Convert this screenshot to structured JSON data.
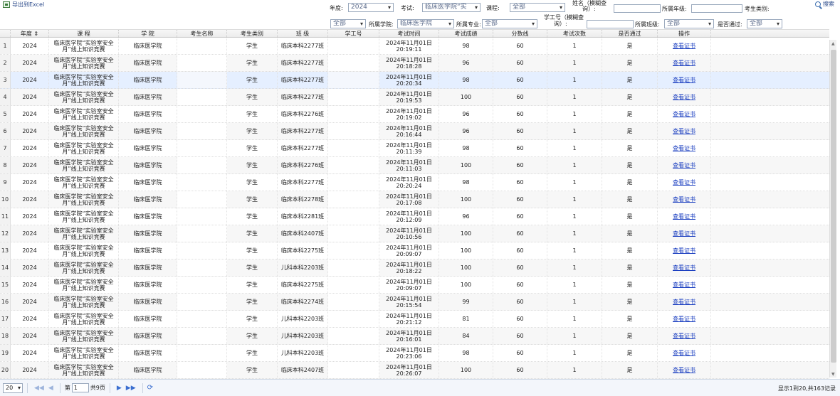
{
  "toolbar": {
    "export_label": "导出到Excel",
    "search_label": "搜索"
  },
  "filters": {
    "year_label": "年度:",
    "year_value": "2024",
    "exam_label": "考试:",
    "exam_value": "临床医学院“实",
    "course_label": "课程:",
    "course_value": "全部",
    "name_label_1": "姓名（模糊查",
    "name_label_2": "询）:",
    "grade_label": "所属年级:",
    "category_label": "考生类别:",
    "category_value": "全部",
    "college_label": "所属学院:",
    "college_value": "临床医学院",
    "major_label": "所属专业:",
    "major_value": "全部",
    "id_label_1": "学工号（模糊查",
    "id_label_2": "询）:",
    "class_label": "所属班级:",
    "class_value": "全部",
    "pass_label": "是否通过:",
    "pass_value": "全部"
  },
  "table": {
    "headers": [
      "",
      "年度 ⇕",
      "课 程",
      "学 院",
      "考生名称",
      "考生类别",
      "班 级",
      "学工号",
      "考试时间",
      "考试成绩",
      "分数线",
      "考试次数",
      "是否通过",
      "操作"
    ],
    "rows": [
      {
        "n": "1",
        "year": "2024",
        "course_1": "临床医学院“实验室安全",
        "course_2": "月”线上知识竞赛",
        "college": "临床医学院",
        "name": "",
        "type": "学生",
        "klass": "临床本科2277班",
        "id": "",
        "date": "2024年11月01日",
        "time": "20:19:11",
        "score": "98",
        "line": "60",
        "times": "1",
        "pass": "是",
        "op": "查看证书"
      },
      {
        "n": "2",
        "year": "2024",
        "course_1": "临床医学院“实验室安全",
        "course_2": "月”线上知识竞赛",
        "college": "临床医学院",
        "name": "",
        "type": "学生",
        "klass": "临床本科2277班",
        "id": "",
        "date": "2024年11月01日",
        "time": "20:18:28",
        "score": "96",
        "line": "60",
        "times": "1",
        "pass": "是",
        "op": "查看证书"
      },
      {
        "n": "3",
        "year": "2024",
        "course_1": "临床医学院“实验室安全",
        "course_2": "月”线上知识竞赛",
        "college": "临床医学院",
        "name": "",
        "type": "学生",
        "klass": "临床本科2277班",
        "id": "",
        "date": "2024年11月01日",
        "time": "20:20:34",
        "score": "98",
        "line": "60",
        "times": "1",
        "pass": "是",
        "op": "查看证书"
      },
      {
        "n": "4",
        "year": "2024",
        "course_1": "临床医学院“实验室安全",
        "course_2": "月”线上知识竞赛",
        "college": "临床医学院",
        "name": "",
        "type": "学生",
        "klass": "临床本科2277班",
        "id": "",
        "date": "2024年11月01日",
        "time": "20:19:53",
        "score": "100",
        "line": "60",
        "times": "1",
        "pass": "是",
        "op": "查看证书"
      },
      {
        "n": "5",
        "year": "2024",
        "course_1": "临床医学院“实验室安全",
        "course_2": "月”线上知识竞赛",
        "college": "临床医学院",
        "name": "",
        "type": "学生",
        "klass": "临床本科2276班",
        "id": "",
        "date": "2024年11月01日",
        "time": "20:19:02",
        "score": "96",
        "line": "60",
        "times": "1",
        "pass": "是",
        "op": "查看证书"
      },
      {
        "n": "6",
        "year": "2024",
        "course_1": "临床医学院“实验室安全",
        "course_2": "月”线上知识竞赛",
        "college": "临床医学院",
        "name": "",
        "type": "学生",
        "klass": "临床本科2277班",
        "id": "",
        "date": "2024年11月01日",
        "time": "20:16:44",
        "score": "96",
        "line": "60",
        "times": "1",
        "pass": "是",
        "op": "查看证书"
      },
      {
        "n": "7",
        "year": "2024",
        "course_1": "临床医学院“实验室安全",
        "course_2": "月”线上知识竞赛",
        "college": "临床医学院",
        "name": "",
        "type": "学生",
        "klass": "临床本科2277班",
        "id": "",
        "date": "2024年11月01日",
        "time": "20:11:39",
        "score": "98",
        "line": "60",
        "times": "1",
        "pass": "是",
        "op": "查看证书"
      },
      {
        "n": "8",
        "year": "2024",
        "course_1": "临床医学院“实验室安全",
        "course_2": "月”线上知识竞赛",
        "college": "临床医学院",
        "name": "",
        "type": "学生",
        "klass": "临床本科2276班",
        "id": "",
        "date": "2024年11月01日",
        "time": "20:11:03",
        "score": "100",
        "line": "60",
        "times": "1",
        "pass": "是",
        "op": "查看证书"
      },
      {
        "n": "9",
        "year": "2024",
        "course_1": "临床医学院“实验室安全",
        "course_2": "月”线上知识竞赛",
        "college": "临床医学院",
        "name": "",
        "type": "学生",
        "klass": "临床本科2277班",
        "id": "",
        "date": "2024年11月01日",
        "time": "20:20:24",
        "score": "98",
        "line": "60",
        "times": "1",
        "pass": "是",
        "op": "查看证书"
      },
      {
        "n": "10",
        "year": "2024",
        "course_1": "临床医学院“实验室安全",
        "course_2": "月”线上知识竞赛",
        "college": "临床医学院",
        "name": "",
        "type": "学生",
        "klass": "临床本科2278班",
        "id": "",
        "date": "2024年11月01日",
        "time": "20:17:08",
        "score": "100",
        "line": "60",
        "times": "1",
        "pass": "是",
        "op": "查看证书"
      },
      {
        "n": "11",
        "year": "2024",
        "course_1": "临床医学院“实验室安全",
        "course_2": "月”线上知识竞赛",
        "college": "临床医学院",
        "name": "",
        "type": "学生",
        "klass": "临床本科2281班",
        "id": "",
        "date": "2024年11月01日",
        "time": "20:12:09",
        "score": "96",
        "line": "60",
        "times": "1",
        "pass": "是",
        "op": "查看证书"
      },
      {
        "n": "12",
        "year": "2024",
        "course_1": "临床医学院“实验室安全",
        "course_2": "月”线上知识竞赛",
        "college": "临床医学院",
        "name": "",
        "type": "学生",
        "klass": "临床本科2407班",
        "id": "",
        "date": "2024年11月01日",
        "time": "20:10:56",
        "score": "100",
        "line": "60",
        "times": "1",
        "pass": "是",
        "op": "查看证书"
      },
      {
        "n": "13",
        "year": "2024",
        "course_1": "临床医学院“实验室安全",
        "course_2": "月”线上知识竞赛",
        "college": "临床医学院",
        "name": "",
        "type": "学生",
        "klass": "临床本科2275班",
        "id": "",
        "date": "2024年11月01日",
        "time": "20:09:07",
        "score": "100",
        "line": "60",
        "times": "1",
        "pass": "是",
        "op": "查看证书"
      },
      {
        "n": "14",
        "year": "2024",
        "course_1": "临床医学院“实验室安全",
        "course_2": "月”线上知识竞赛",
        "college": "临床医学院",
        "name": "",
        "type": "学生",
        "klass": "儿科本科2203班",
        "id": "",
        "date": "2024年11月01日",
        "time": "20:18:22",
        "score": "100",
        "line": "60",
        "times": "1",
        "pass": "是",
        "op": "查看证书"
      },
      {
        "n": "15",
        "year": "2024",
        "course_1": "临床医学院“实验室安全",
        "course_2": "月”线上知识竞赛",
        "college": "临床医学院",
        "name": "",
        "type": "学生",
        "klass": "临床本科2275班",
        "id": "",
        "date": "2024年11月01日",
        "time": "20:09:07",
        "score": "100",
        "line": "60",
        "times": "1",
        "pass": "是",
        "op": "查看证书"
      },
      {
        "n": "16",
        "year": "2024",
        "course_1": "临床医学院“实验室安全",
        "course_2": "月”线上知识竞赛",
        "college": "临床医学院",
        "name": "",
        "type": "学生",
        "klass": "临床本科2274班",
        "id": "",
        "date": "2024年11月01日",
        "time": "20:15:54",
        "score": "99",
        "line": "60",
        "times": "1",
        "pass": "是",
        "op": "查看证书"
      },
      {
        "n": "17",
        "year": "2024",
        "course_1": "临床医学院“实验室安全",
        "course_2": "月”线上知识竞赛",
        "college": "临床医学院",
        "name": "",
        "type": "学生",
        "klass": "儿科本科2203班",
        "id": "",
        "date": "2024年11月01日",
        "time": "20:21:12",
        "score": "81",
        "line": "60",
        "times": "1",
        "pass": "是",
        "op": "查看证书"
      },
      {
        "n": "18",
        "year": "2024",
        "course_1": "临床医学院“实验室安全",
        "course_2": "月”线上知识竞赛",
        "college": "临床医学院",
        "name": "",
        "type": "学生",
        "klass": "儿科本科2203班",
        "id": "",
        "date": "2024年11月01日",
        "time": "20:16:01",
        "score": "84",
        "line": "60",
        "times": "1",
        "pass": "是",
        "op": "查看证书"
      },
      {
        "n": "19",
        "year": "2024",
        "course_1": "临床医学院“实验室安全",
        "course_2": "月”线上知识竞赛",
        "college": "临床医学院",
        "name": "",
        "type": "学生",
        "klass": "儿科本科2203班",
        "id": "",
        "date": "2024年11月01日",
        "time": "20:23:06",
        "score": "98",
        "line": "60",
        "times": "1",
        "pass": "是",
        "op": "查看证书"
      },
      {
        "n": "20",
        "year": "2024",
        "course_1": "临床医学院“实验室安全",
        "course_2": "月”线上知识竞赛",
        "college": "临床医学院",
        "name": "",
        "type": "学生",
        "klass": "临床本科2407班",
        "id": "",
        "date": "2024年11月01日",
        "time": "20:26:07",
        "score": "100",
        "line": "60",
        "times": "1",
        "pass": "是",
        "op": "查看证书"
      }
    ]
  },
  "pager": {
    "page_size": "20",
    "page_prefix": "第",
    "page_value": "1",
    "page_suffix": "共9页",
    "info": "显示1到20,共163记录"
  },
  "icons": {
    "export": "excel-icon",
    "search": "search-icon",
    "first": "◀◀",
    "prev": "◀",
    "next": "▶",
    "last": "▶▶",
    "refresh": "⟳"
  }
}
